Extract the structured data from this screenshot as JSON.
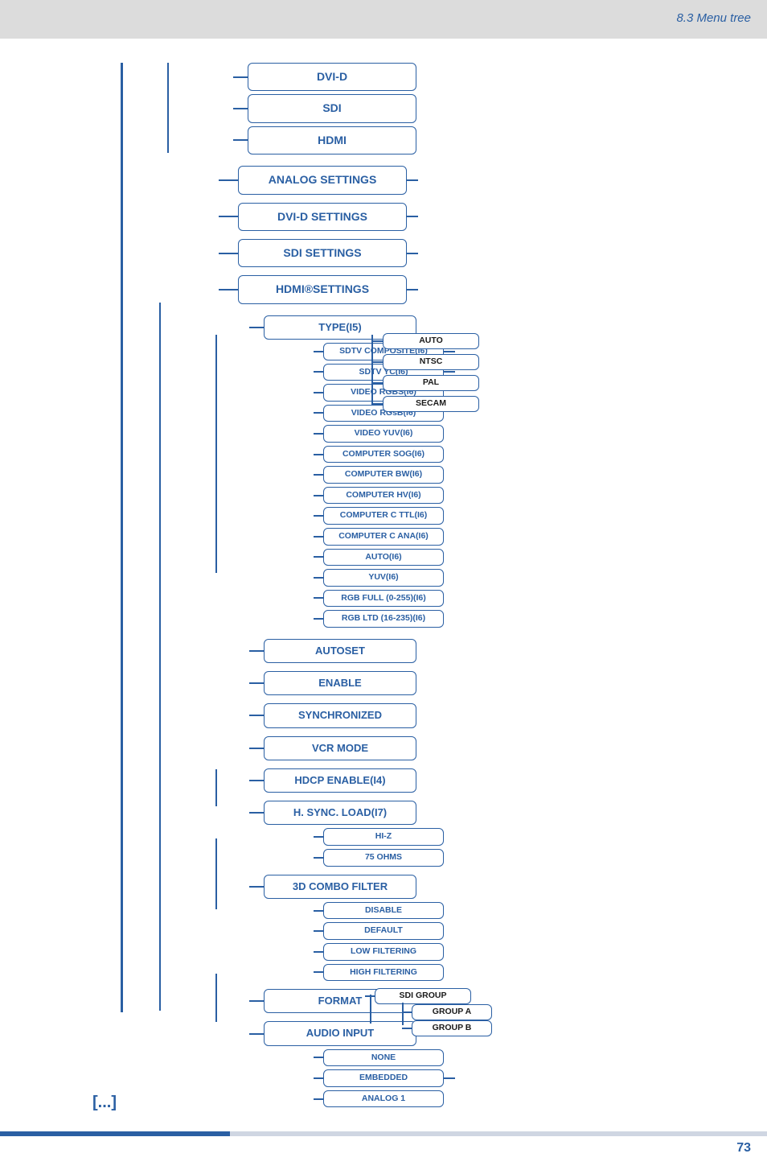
{
  "header": {
    "breadcrumb": "8.3 Menu tree"
  },
  "footer": {
    "page": "73"
  },
  "continuation_marker": "[...]",
  "inputs": {
    "dvi_d": "DVI-D",
    "sdi": "SDI",
    "hdmi": "HDMI"
  },
  "settings": {
    "analog": "ANALOG SETTINGS",
    "dvi_d": "DVI-D SETTINGS",
    "sdi": "SDI SETTINGS",
    "hdmi": "HDMI®SETTINGS"
  },
  "type": {
    "label": "TYPE(I5)",
    "options": {
      "sdtv_composite": "SDTV COMPOSITE(I6)",
      "sdtv_yc": "SDTV YC(I6)",
      "video_rgbs": "VIDEO RGBS(I6)",
      "video_rgsb": "VIDEO RGsB(I6)",
      "video_yuv": "VIDEO YUV(I6)",
      "computer_sog": "COMPUTER SOG(I6)",
      "computer_bw": "COMPUTER BW(I6)",
      "computer_hv": "COMPUTER HV(I6)",
      "computer_c_ttl": "COMPUTER C TTL(I6)",
      "computer_c_ana": "COMPUTER C ANA(I6)",
      "auto": "AUTO(I6)",
      "yuv": "YUV(I6)",
      "rgb_full": "RGB FULL (0-255)(I6)",
      "rgb_ltd": "RGB LTD (16-235)(I6)"
    }
  },
  "video_standards": {
    "auto": "AUTO",
    "ntsc": "NTSC",
    "pal": "PAL",
    "secam": "SECAM"
  },
  "children": {
    "autoset": "AUTOSET",
    "enable": "ENABLE",
    "synchronized": "SYNCHRONIZED",
    "vcr_mode": "VCR MODE",
    "hdcp_enable": "HDCP ENABLE(I4)",
    "h_sync_load": "H. SYNC. LOAD(I7)",
    "combo_filter": "3D COMBO FILTER",
    "format": "FORMAT",
    "audio_input": "AUDIO INPUT"
  },
  "h_sync_load_opts": {
    "hi_z": "HI-Z",
    "ohm75": "75 OHMS"
  },
  "combo_filter_opts": {
    "disable": "DISABLE",
    "default": "DEFAULT",
    "low": "LOW FILTERING",
    "high": "HIGH FILTERING"
  },
  "audio_input_opts": {
    "none": "NONE",
    "embedded": "EMBEDDED",
    "analog1": "ANALOG 1"
  },
  "sdi_group": {
    "label": "SDI GROUP",
    "group_a": "GROUP A",
    "group_b": "GROUP B"
  }
}
